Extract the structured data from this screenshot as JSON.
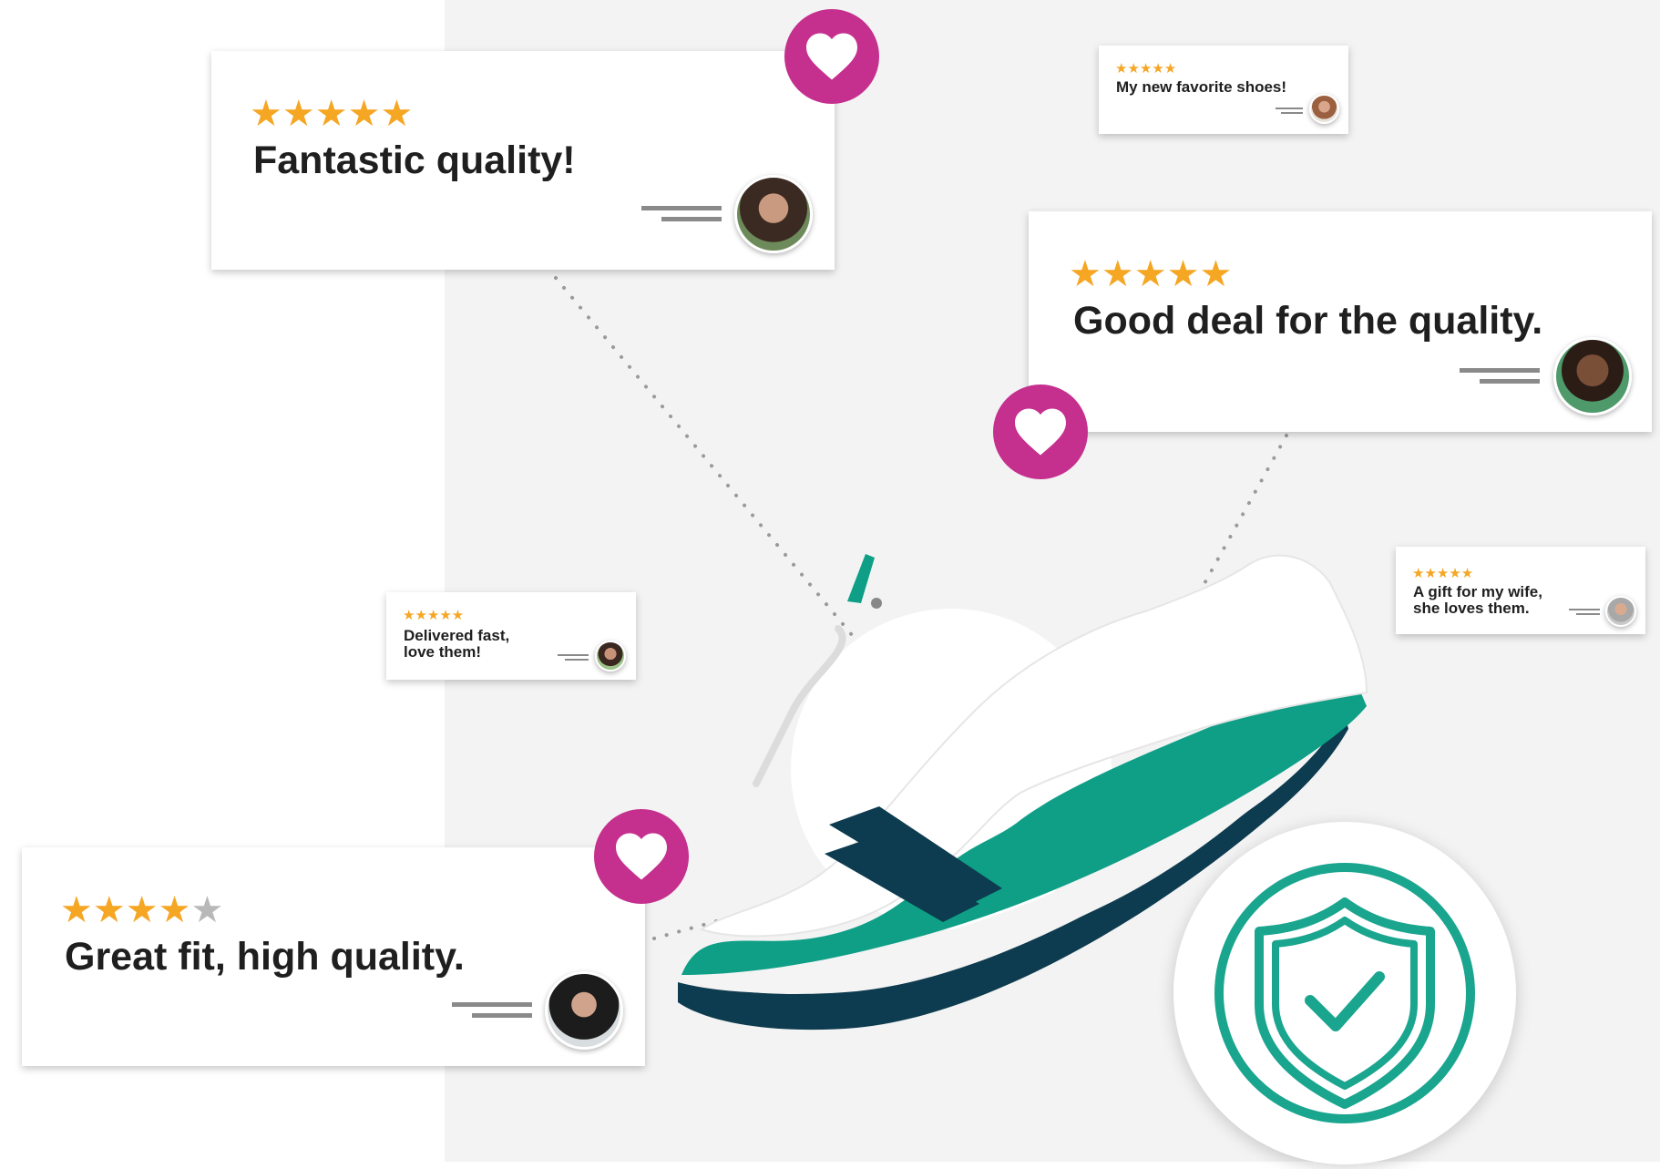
{
  "reviews": {
    "fantastic": {
      "title": "Fantastic quality!",
      "stars": "★★★★★",
      "rating": 5
    },
    "favorite": {
      "title": "My new favorite shoes!",
      "stars": "★★★★★",
      "rating": 5
    },
    "good_deal": {
      "title": "Good deal for the quality.",
      "stars": "★★★★★",
      "rating": 5
    },
    "delivered": {
      "title_line1": "Delivered fast,",
      "title_line2": "love them!",
      "stars": "★★★★★",
      "rating": 5
    },
    "gift": {
      "title_line1": "A gift for my wife,",
      "title_line2": "she loves them.",
      "stars": "★★★★★",
      "rating": 5
    },
    "great_fit": {
      "title": "Great fit, high quality.",
      "stars_on": "★★★★",
      "stars_off": "★",
      "rating": 4
    }
  },
  "colors": {
    "star": "#f5a623",
    "heart_badge": "#c52f8e",
    "teal": "#0e9f86",
    "navy": "#0d3b4f",
    "background_panel": "#f3f3f3"
  },
  "icons": {
    "heart": "heart-icon",
    "shield": "shield-check-icon"
  }
}
